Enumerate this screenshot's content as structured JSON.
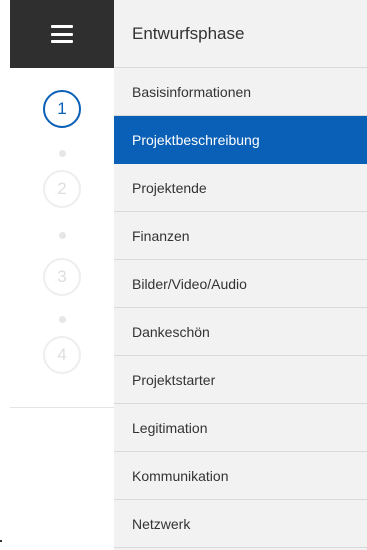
{
  "menu": {
    "toggle_icon": "hamburger-icon",
    "section_title": "Entwurfsphase"
  },
  "steps": [
    {
      "number": "1",
      "state": "active"
    },
    {
      "number": "2",
      "state": "inactive"
    },
    {
      "number": "3",
      "state": "inactive"
    },
    {
      "number": "4",
      "state": "inactive"
    }
  ],
  "nav": {
    "items": [
      {
        "label": "Basisinformationen"
      },
      {
        "label": "Projektbeschreibung",
        "active": true
      },
      {
        "label": "Projektende"
      },
      {
        "label": "Finanzen"
      },
      {
        "label": "Bilder/Video/Audio"
      },
      {
        "label": "Dankeschön"
      },
      {
        "label": "Projektstarter"
      },
      {
        "label": "Legitimation"
      },
      {
        "label": "Kommunikation"
      },
      {
        "label": "Netzwerk"
      }
    ]
  },
  "colors": {
    "accent": "#0a60b6",
    "toggle_background": "#2f2f2f",
    "panel_background": "#f2f2f2"
  }
}
